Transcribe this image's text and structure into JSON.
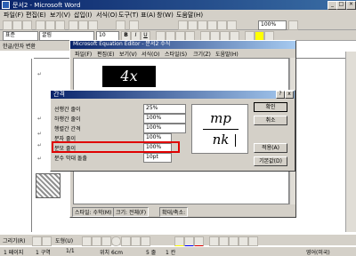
{
  "window": {
    "title": "문서2 - Microsoft Word"
  },
  "menu": [
    "파일(F)",
    "편집(E)",
    "보기(V)",
    "삽입(I)",
    "서식(O)",
    "도구(T)",
    "표(A)",
    "창(W)",
    "도움말(H)"
  ],
  "formatting": {
    "style": "표준",
    "font": "굴림",
    "size": "10",
    "zoom": "100%"
  },
  "hangul_toolbar": {
    "label": "한글/한자 변환"
  },
  "equation_editor": {
    "title": "Microsoft Equation Editor - 문서2 수식",
    "menu": [
      "파일(F)",
      "편집(E)",
      "보기(V)",
      "서식(O)",
      "스타일(S)",
      "크기(Z)",
      "도움말(H)"
    ],
    "preview_expr": "4x",
    "status": [
      "스타일: 수학(M)",
      "크기: 전체(F)",
      "확대/축소:"
    ]
  },
  "spacing_dialog": {
    "title": "간격",
    "help": "?",
    "close": "x",
    "rows": [
      {
        "label": "선행간 줄이",
        "value": "25%"
      },
      {
        "label": "하행간 줄이",
        "value": "100%"
      },
      {
        "label": "행렬간 간격",
        "value": "100%"
      },
      {
        "label": "분자 줄이",
        "value": "100%"
      },
      {
        "label": "분모 줄이",
        "value": "100%"
      },
      {
        "label": "분수 막대 돌출",
        "value": "10pt"
      }
    ],
    "buttons": {
      "ok": "확인",
      "cancel": "취소",
      "apply": "적용(A)",
      "default": "기본값(D)"
    },
    "preview": {
      "numerator": "mp",
      "denominator": "nk"
    }
  },
  "drawing_toolbar": {
    "draw_label": "그리기(R)",
    "autoshapes_label": "도형(U)"
  },
  "status_bar": {
    "page": "1 페이지",
    "section": "1 구역",
    "pages": "1/1",
    "position": "위치 6cm",
    "line": "5 줄",
    "column": "1 칸",
    "language": "영어(미국)"
  },
  "colors": {
    "highlight_box": "#e00000",
    "title_blue": "#0a246a",
    "face": "#d4d0c8"
  }
}
